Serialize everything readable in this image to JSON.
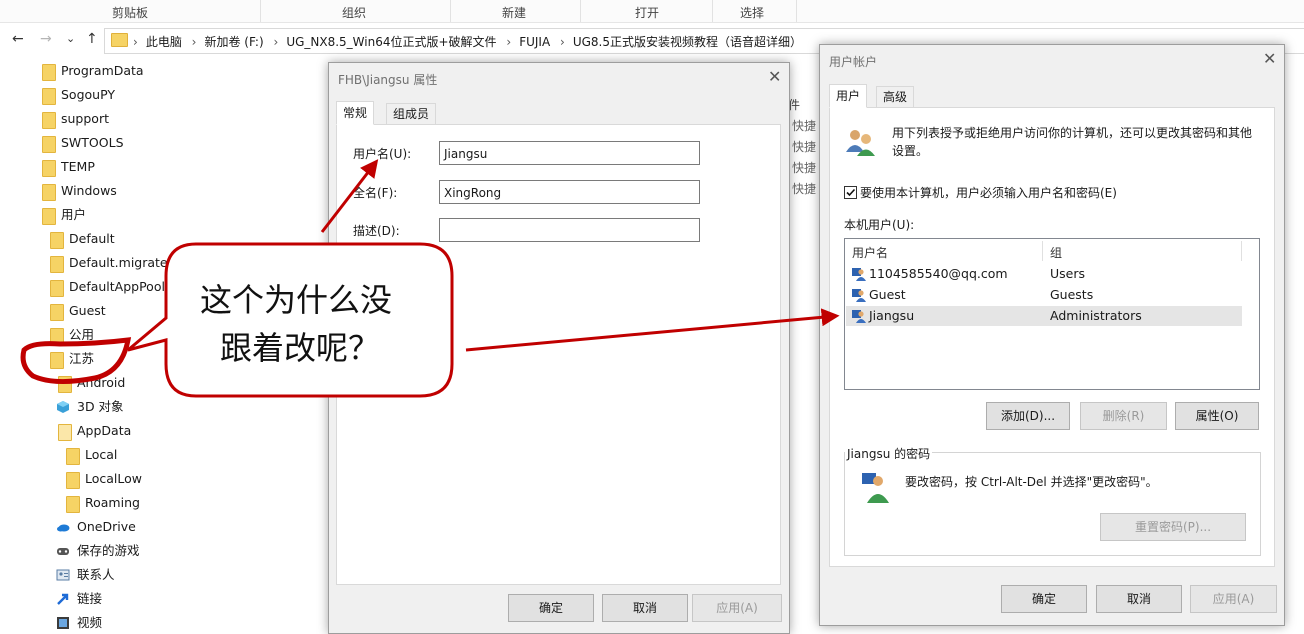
{
  "ribbon": {
    "groups": [
      "剪贴板",
      "组织",
      "新建",
      "打开",
      "选择"
    ]
  },
  "address": {
    "back_icon": "←",
    "forward_icon": "→",
    "recent_icon": "⌄",
    "up_icon": "↑",
    "crumbs": [
      "此电脑",
      "新加卷 (F:)",
      "UG_NX8.5_Win64位正式版+破解文件",
      "FUJIA",
      "UG8.5正式版安装视频教程（语音超详细）"
    ],
    "separator": "›"
  },
  "tree": {
    "items": [
      {
        "label": "ProgramData",
        "icon": "folder-icon"
      },
      {
        "label": "SogouPY",
        "icon": "folder-icon"
      },
      {
        "label": "support",
        "icon": "folder-icon"
      },
      {
        "label": "SWTOOLS",
        "icon": "folder-icon"
      },
      {
        "label": "TEMP",
        "icon": "folder-icon"
      },
      {
        "label": "Windows",
        "icon": "folder-icon"
      },
      {
        "label": "用户",
        "icon": "folder-icon"
      },
      {
        "label": "Default",
        "icon": "folder-icon"
      },
      {
        "label": "Default.migrated",
        "icon": "folder-icon"
      },
      {
        "label": "DefaultAppPool",
        "icon": "folder-icon"
      },
      {
        "label": "Guest",
        "icon": "folder-icon"
      },
      {
        "label": "公用",
        "icon": "folder-icon"
      },
      {
        "label": "江苏",
        "icon": "folder-icon"
      },
      {
        "label": "Android",
        "icon": "folder-icon"
      },
      {
        "label": "3D 对象",
        "icon": "3d-objects-icon"
      },
      {
        "label": "AppData",
        "icon": "folder-icon"
      },
      {
        "label": "Local",
        "icon": "folder-icon"
      },
      {
        "label": "LocalLow",
        "icon": "folder-icon"
      },
      {
        "label": "Roaming",
        "icon": "folder-icon"
      },
      {
        "label": "OneDrive",
        "icon": "onedrive-icon"
      },
      {
        "label": "保存的游戏",
        "icon": "saved-games-icon"
      },
      {
        "label": "联系人",
        "icon": "contacts-icon"
      },
      {
        "label": "链接",
        "icon": "links-icon"
      },
      {
        "label": "视频",
        "icon": "videos-icon"
      }
    ]
  },
  "backdrop": {
    "column_header": "件",
    "quick_items": [
      "快捷",
      "快捷",
      "快捷",
      "快捷"
    ]
  },
  "props_dialog": {
    "title": "FHB\\Jiangsu 属性",
    "close": "✕",
    "tabs": [
      "常规",
      "组成员"
    ],
    "fields": [
      {
        "label": "用户名(U):",
        "value": "Jiangsu"
      },
      {
        "label": "全名(F):",
        "value": "XingRong"
      },
      {
        "label": "描述(D):",
        "value": ""
      }
    ],
    "buttons": {
      "ok": "确定",
      "cancel": "取消",
      "apply": "应用(A)"
    }
  },
  "accounts_dialog": {
    "title": "用户帐户",
    "close": "✕",
    "tabs": [
      "用户",
      "高级"
    ],
    "intro": "用下列表授予或拒绝用户访问你的计算机，还可以更改其密码和其他设置。",
    "checkbox_label": "要使用本计算机，用户必须输入用户名和密码(E)",
    "checkbox_checked": true,
    "list_caption": "本机用户(U):",
    "columns": [
      "用户名",
      "组"
    ],
    "users": [
      {
        "name": "1104585540@qq.com",
        "group": "Users",
        "selected": false
      },
      {
        "name": "Guest",
        "group": "Guests",
        "selected": false
      },
      {
        "name": "Jiangsu",
        "group": "Administrators",
        "selected": true
      }
    ],
    "list_buttons": {
      "add": "添加(D)...",
      "remove": "删除(R)",
      "properties": "属性(O)"
    },
    "password_group": "Jiangsu 的密码",
    "password_text": "要改密码，按 Ctrl-Alt-Del 并选择\"更改密码\"。",
    "reset_button": "重置密码(P)...",
    "buttons": {
      "ok": "确定",
      "cancel": "取消",
      "apply": "应用(A)"
    }
  },
  "annotation": {
    "lines": [
      "这个为什么没",
      "跟着改呢？"
    ],
    "accent": "#c00000"
  }
}
